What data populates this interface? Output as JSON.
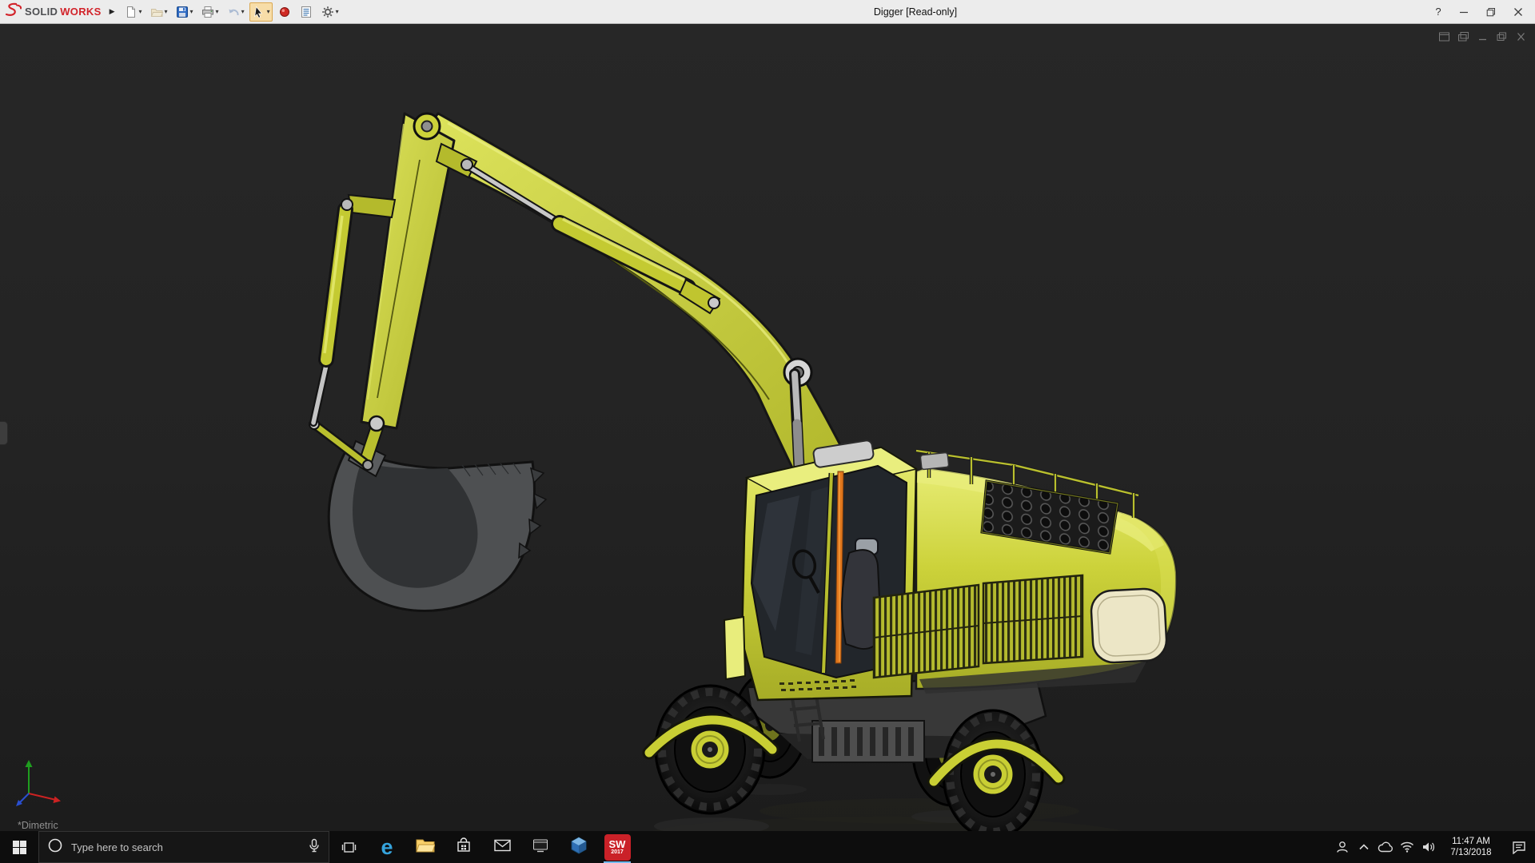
{
  "titlebar": {
    "logo_solid": "SOLID",
    "logo_works": "WORKS",
    "flyout": "▶",
    "caret": "▾",
    "title": "Digger [Read-only]",
    "help": "?"
  },
  "toolbar": {
    "icons": [
      "new-document",
      "open",
      "save",
      "print",
      "undo",
      "select",
      "rebuild",
      "file-properties",
      "options"
    ]
  },
  "viewport": {
    "view_label": "*Dimetric",
    "background": "#232323"
  },
  "model": {
    "name": "Digger excavator",
    "body_color": "#ccd23a",
    "highlight_color": "#e9ee7e",
    "cab_accent_orange": "#e0761c",
    "bucket_color": "#4e5052"
  },
  "taskbar": {
    "search_placeholder": "Type here to search",
    "edge_glyph": "e",
    "sw_label": "SW",
    "sw_year": "2017",
    "clock_time": "11:47 AM",
    "clock_date": "7/13/2018"
  }
}
